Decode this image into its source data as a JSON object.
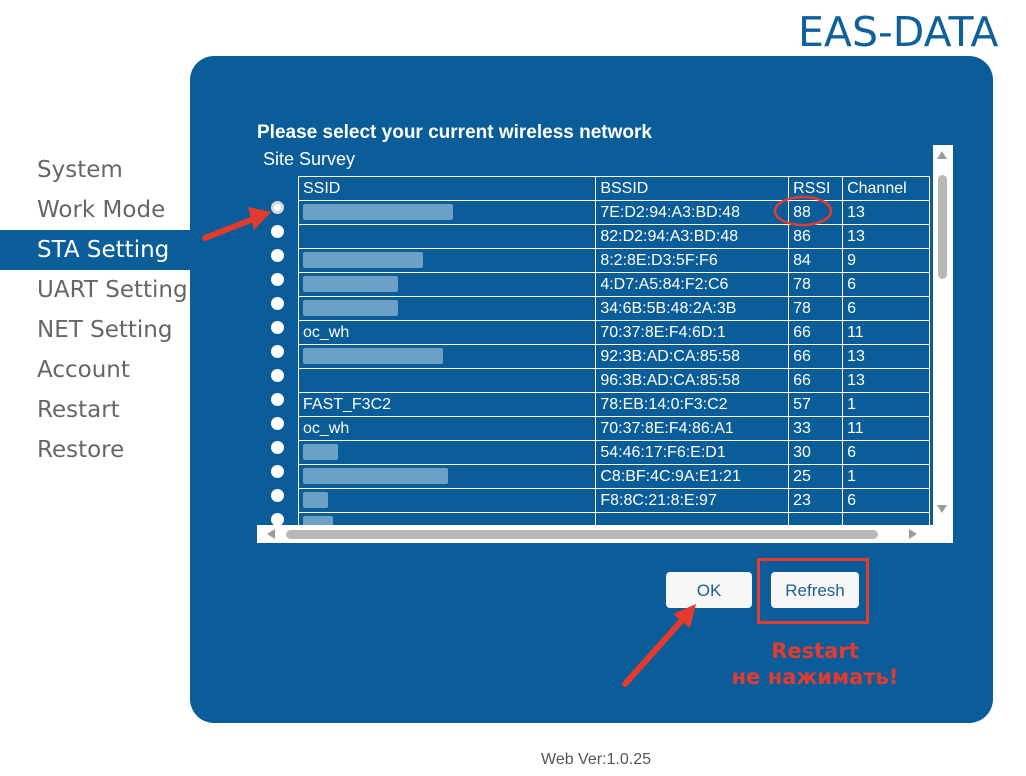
{
  "brand": "EAS-DATA",
  "sidebar": {
    "items": [
      {
        "label": "System"
      },
      {
        "label": "Work Mode"
      },
      {
        "label": "STA Setting"
      },
      {
        "label": "UART Setting"
      },
      {
        "label": "NET Setting"
      },
      {
        "label": "Account"
      },
      {
        "label": "Restart"
      },
      {
        "label": "Restore"
      }
    ],
    "active_index": 2
  },
  "panel": {
    "heading": "Please select your current wireless network",
    "survey_label": "Site Survey",
    "columns": [
      "SSID",
      "BSSID",
      "RSSI",
      "Channel"
    ],
    "rows": [
      {
        "ssid": "",
        "bssid": "7E:D2:94:A3:BD:48",
        "rssi": "88",
        "channel": "13"
      },
      {
        "ssid": "",
        "bssid": "82:D2:94:A3:BD:48",
        "rssi": "86",
        "channel": "13"
      },
      {
        "ssid": "",
        "bssid": "8:2:8E:D3:5F:F6",
        "rssi": "84",
        "channel": "9"
      },
      {
        "ssid": "",
        "bssid": "4:D7:A5:84:F2:C6",
        "rssi": "78",
        "channel": "6"
      },
      {
        "ssid": "",
        "bssid": "34:6B:5B:48:2A:3B",
        "rssi": "78",
        "channel": "6"
      },
      {
        "ssid": "oc_wh",
        "bssid": "70:37:8E:F4:6D:1",
        "rssi": "66",
        "channel": "11"
      },
      {
        "ssid": "",
        "bssid": "92:3B:AD:CA:85:58",
        "rssi": "66",
        "channel": "13"
      },
      {
        "ssid": "",
        "bssid": "96:3B:AD:CA:85:58",
        "rssi": "66",
        "channel": "13"
      },
      {
        "ssid": "FAST_F3C2",
        "bssid": "78:EB:14:0:F3:C2",
        "rssi": "57",
        "channel": "1"
      },
      {
        "ssid": "oc_wh",
        "bssid": "70:37:8E:F4:86:A1",
        "rssi": "33",
        "channel": "11"
      },
      {
        "ssid": "",
        "bssid": "54:46:17:F6:E:D1",
        "rssi": "30",
        "channel": "6"
      },
      {
        "ssid": "",
        "bssid": "C8:BF:4C:9A:E1:21",
        "rssi": "25",
        "channel": "1"
      },
      {
        "ssid": "",
        "bssid": "F8:8C:21:8:E:97",
        "rssi": "23",
        "channel": "6"
      },
      {
        "ssid": "",
        "bssid": "",
        "rssi": "",
        "channel": ""
      }
    ],
    "selected_row": 0
  },
  "buttons": {
    "ok": "OK",
    "refresh": "Refresh"
  },
  "annotation": {
    "line1": "Restart",
    "line2": "не нажимать!"
  },
  "footer": {
    "version": "Web Ver:1.0.25"
  },
  "colors": {
    "panel": "#0a5d99",
    "brand": "#10609c",
    "annotation_red": "#e53b2f"
  }
}
